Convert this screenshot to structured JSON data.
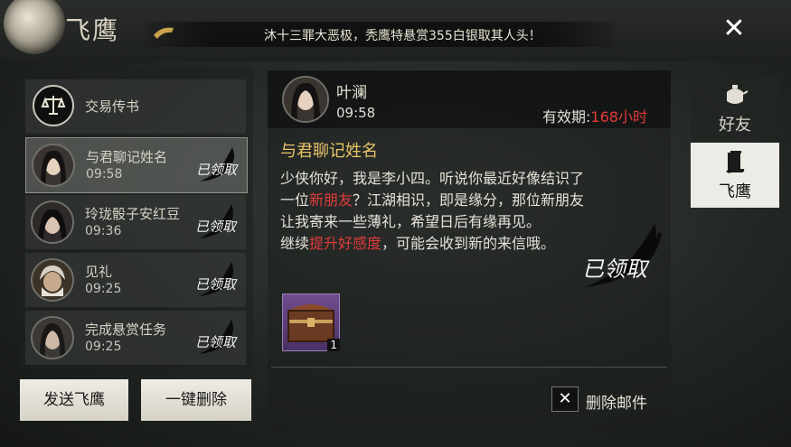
{
  "header": {
    "title": "飞鹰",
    "banner": "沐十三罪大恶极，秃鹰特悬赏355白银取其人头！",
    "close_icon": "close-icon"
  },
  "mail_list": [
    {
      "title": "交易传书",
      "time": "",
      "icon": "scales-icon",
      "claimed": false
    },
    {
      "title": "与君聊记姓名",
      "time": "09:58",
      "claimed": true,
      "selected": true
    },
    {
      "title": "玲珑骰子安红豆",
      "time": "09:36",
      "claimed": true
    },
    {
      "title": "见礼",
      "time": "09:25",
      "claimed": true
    },
    {
      "title": "完成悬赏任务",
      "time": "09:25",
      "claimed": true
    }
  ],
  "stamp_text": "已领取",
  "buttons": {
    "send": "发送飞鹰",
    "delete_all": "一键删除"
  },
  "detail": {
    "sender": "叶澜",
    "time": "09:58",
    "validity_label": "有效期:",
    "validity_value": "168小时",
    "heading": "与君聊记姓名",
    "body_1": "少侠你好，我是李小四。听说你最近好像结识了",
    "body_2a": "一位",
    "body_2b": "新朋友",
    "body_2c": "？江湖相识，即是缘分，那位新朋友",
    "body_3": "让我寄来一些薄礼，希望日后有缘再见。",
    "body_4a": "继续",
    "body_4b": "提升好感度",
    "body_4c": "，可能会收到新的来信哦。",
    "attachment_count": "1",
    "delete_label": "删除邮件"
  },
  "tabs": [
    {
      "label": "好友",
      "icon": "teapot-icon",
      "active": false
    },
    {
      "label": "飞鹰",
      "icon": "scroll-icon",
      "active": true
    }
  ],
  "colors": {
    "highlight_red": "#e03c3c",
    "heading_gold": "#e8c368",
    "tab_active": "#ecebe6"
  }
}
